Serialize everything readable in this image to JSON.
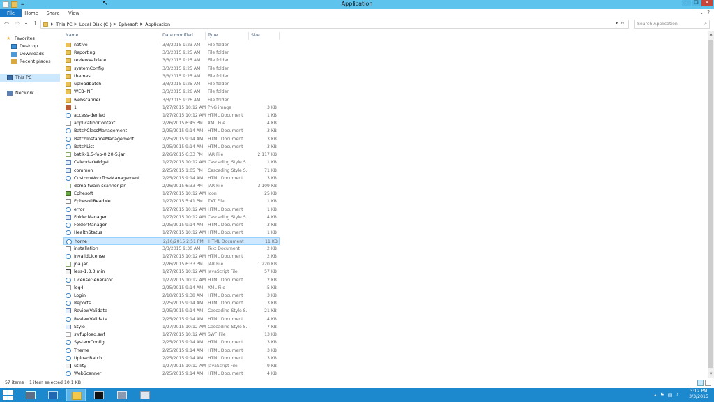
{
  "window": {
    "title": "Application",
    "quick_access": {
      "properties": "Properties",
      "new_folder": "New folder",
      "customize": "="
    }
  },
  "ribbon": {
    "tabs": [
      "File",
      "Home",
      "Share",
      "View"
    ],
    "help": "?"
  },
  "address": {
    "crumbs": [
      "This PC",
      "Local Disk (C:)",
      "Ephesoft",
      "Application"
    ],
    "search_placeholder": "Search Application"
  },
  "nav_pane": {
    "favorites": "Favorites",
    "favorite_items": [
      "Desktop",
      "Downloads",
      "Recent places"
    ],
    "this_pc": "This PC",
    "network": "Network"
  },
  "columns": {
    "name": "Name",
    "date": "Date modified",
    "type": "Type",
    "size": "Size"
  },
  "files": [
    {
      "name": "native",
      "date": "3/3/2015 9:23 AM",
      "type": "File folder",
      "size": "",
      "kind": "folder"
    },
    {
      "name": "Reporting",
      "date": "3/3/2015 9:25 AM",
      "type": "File folder",
      "size": "",
      "kind": "folder"
    },
    {
      "name": "reviewValidate",
      "date": "3/3/2015 9:25 AM",
      "type": "File folder",
      "size": "",
      "kind": "folder"
    },
    {
      "name": "systemConfig",
      "date": "3/3/2015 9:25 AM",
      "type": "File folder",
      "size": "",
      "kind": "folder"
    },
    {
      "name": "themes",
      "date": "3/3/2015 9:25 AM",
      "type": "File folder",
      "size": "",
      "kind": "folder"
    },
    {
      "name": "uploadbatch",
      "date": "3/3/2015 9:25 AM",
      "type": "File folder",
      "size": "",
      "kind": "folder"
    },
    {
      "name": "WEB-INF",
      "date": "3/3/2015 9:26 AM",
      "type": "File folder",
      "size": "",
      "kind": "folder"
    },
    {
      "name": "webscanner",
      "date": "3/3/2015 9:26 AM",
      "type": "File folder",
      "size": "",
      "kind": "folder"
    },
    {
      "name": "1",
      "date": "1/27/2015 10:12 AM",
      "type": "PNG image",
      "size": "3 KB",
      "kind": "png"
    },
    {
      "name": "access-denied",
      "date": "1/27/2015 10:12 AM",
      "type": "HTML Document",
      "size": "1 KB",
      "kind": "html"
    },
    {
      "name": "applicationContext",
      "date": "2/26/2015 6:45 PM",
      "type": "XML File",
      "size": "4 KB",
      "kind": "xml"
    },
    {
      "name": "BatchClassManagement",
      "date": "2/25/2015 9:14 AM",
      "type": "HTML Document",
      "size": "3 KB",
      "kind": "html"
    },
    {
      "name": "BatchInstanceManagement",
      "date": "2/25/2015 9:14 AM",
      "type": "HTML Document",
      "size": "3 KB",
      "kind": "html"
    },
    {
      "name": "BatchList",
      "date": "2/25/2015 9:14 AM",
      "type": "HTML Document",
      "size": "3 KB",
      "kind": "html"
    },
    {
      "name": "batik-1.5-fop-0.20-5.jar",
      "date": "2/26/2015 6:33 PM",
      "type": "JAR File",
      "size": "2,117 KB",
      "kind": "jar"
    },
    {
      "name": "CalendarWidget",
      "date": "1/27/2015 10:12 AM",
      "type": "Cascading Style S...",
      "size": "1 KB",
      "kind": "css"
    },
    {
      "name": "common",
      "date": "2/25/2015 1:05 PM",
      "type": "Cascading Style S...",
      "size": "71 KB",
      "kind": "css"
    },
    {
      "name": "CustomWorkflowManagement",
      "date": "2/25/2015 9:14 AM",
      "type": "HTML Document",
      "size": "3 KB",
      "kind": "html"
    },
    {
      "name": "dcma-twain-scanner.jar",
      "date": "2/26/2015 6:33 PM",
      "type": "JAR File",
      "size": "3,109 KB",
      "kind": "jar"
    },
    {
      "name": "Ephesoft",
      "date": "1/27/2015 10:12 AM",
      "type": "Icon",
      "size": "25 KB",
      "kind": "icon"
    },
    {
      "name": "EphesoftReadMe",
      "date": "1/27/2015 5:41 PM",
      "type": "TXT File",
      "size": "1 KB",
      "kind": "txt"
    },
    {
      "name": "error",
      "date": "1/27/2015 10:12 AM",
      "type": "HTML Document",
      "size": "1 KB",
      "kind": "html"
    },
    {
      "name": "FolderManager",
      "date": "1/27/2015 10:12 AM",
      "type": "Cascading Style S...",
      "size": "4 KB",
      "kind": "css"
    },
    {
      "name": "FolderManager",
      "date": "2/25/2015 9:14 AM",
      "type": "HTML Document",
      "size": "3 KB",
      "kind": "html"
    },
    {
      "name": "HealthStatus",
      "date": "1/27/2015 10:12 AM",
      "type": "HTML Document",
      "size": "1 KB",
      "kind": "html"
    },
    {
      "name": "home",
      "date": "2/16/2015 2:51 PM",
      "type": "HTML Document",
      "size": "11 KB",
      "kind": "html",
      "selected": true
    },
    {
      "name": "installation",
      "date": "3/3/2015 9:30 AM",
      "type": "Text Document",
      "size": "2 KB",
      "kind": "txt"
    },
    {
      "name": "InvalidLicense",
      "date": "1/27/2015 10:12 AM",
      "type": "HTML Document",
      "size": "2 KB",
      "kind": "html"
    },
    {
      "name": "jna.jar",
      "date": "2/26/2015 6:33 PM",
      "type": "JAR File",
      "size": "1,220 KB",
      "kind": "jar"
    },
    {
      "name": "less-1.3.3.min",
      "date": "1/27/2015 10:12 AM",
      "type": "JavaScript File",
      "size": "57 KB",
      "kind": "js"
    },
    {
      "name": "LicenseGenerator",
      "date": "1/27/2015 10:12 AM",
      "type": "HTML Document",
      "size": "2 KB",
      "kind": "html"
    },
    {
      "name": "log4j",
      "date": "2/25/2015 9:14 AM",
      "type": "XML File",
      "size": "5 KB",
      "kind": "xml"
    },
    {
      "name": "Login",
      "date": "2/10/2015 9:38 AM",
      "type": "HTML Document",
      "size": "3 KB",
      "kind": "html"
    },
    {
      "name": "Reports",
      "date": "2/25/2015 9:14 AM",
      "type": "HTML Document",
      "size": "3 KB",
      "kind": "html"
    },
    {
      "name": "ReviewValidate",
      "date": "2/25/2015 9:14 AM",
      "type": "Cascading Style S...",
      "size": "21 KB",
      "kind": "css"
    },
    {
      "name": "ReviewValidate",
      "date": "2/25/2015 9:14 AM",
      "type": "HTML Document",
      "size": "4 KB",
      "kind": "html"
    },
    {
      "name": "Style",
      "date": "1/27/2015 10:12 AM",
      "type": "Cascading Style S...",
      "size": "7 KB",
      "kind": "css"
    },
    {
      "name": "swfupload.swf",
      "date": "1/27/2015 10:12 AM",
      "type": "SWF File",
      "size": "13 KB",
      "kind": "swf"
    },
    {
      "name": "SystemConfig",
      "date": "2/25/2015 9:14 AM",
      "type": "HTML Document",
      "size": "3 KB",
      "kind": "html"
    },
    {
      "name": "Theme",
      "date": "2/25/2015 9:14 AM",
      "type": "HTML Document",
      "size": "3 KB",
      "kind": "html"
    },
    {
      "name": "UploadBatch",
      "date": "2/25/2015 9:14 AM",
      "type": "HTML Document",
      "size": "3 KB",
      "kind": "html"
    },
    {
      "name": "utility",
      "date": "1/27/2015 10:12 AM",
      "type": "JavaScript File",
      "size": "9 KB",
      "kind": "js"
    },
    {
      "name": "WebScanner",
      "date": "2/25/2015 9:14 AM",
      "type": "HTML Document",
      "size": "4 KB",
      "kind": "html"
    }
  ],
  "status": {
    "items": "57 items",
    "selected": "1 item selected  10.1 KB"
  },
  "taskbar": {
    "apps": [
      "server-manager",
      "powershell",
      "file-explorer",
      "command-prompt",
      "admin-tools",
      "application-window"
    ],
    "clock_time": "3:12 PM",
    "clock_date": "3/3/2015"
  },
  "colors": {
    "titlebar": "#5ec4ee",
    "file_tab": "#1979ca",
    "taskbar": "#1c88cd",
    "selection": "#cde8ff"
  }
}
